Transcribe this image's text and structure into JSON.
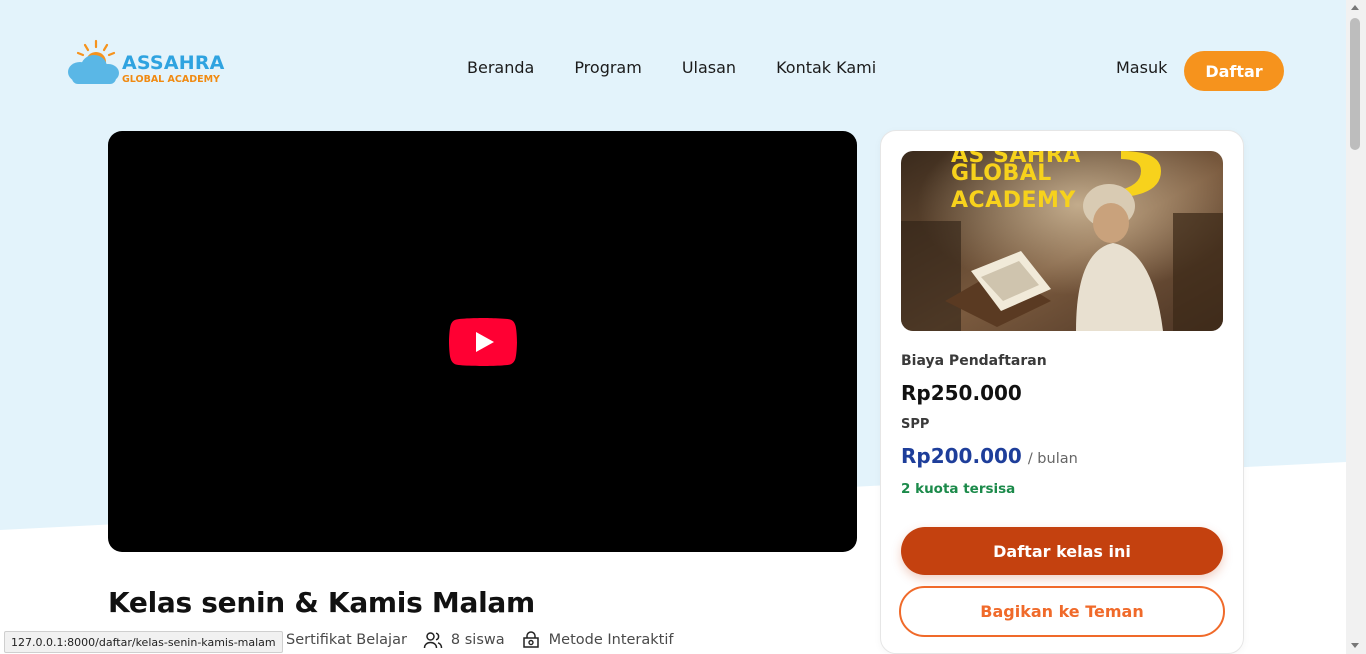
{
  "nav": {
    "logo_title": "ASSAHRA",
    "logo_subtitle": "GLOBAL ACADEMY",
    "links": [
      "Beranda",
      "Program",
      "Ulasan",
      "Kontak Kami"
    ],
    "login_label": "Masuk",
    "register_label": "Daftar"
  },
  "video": {
    "play_icon": "youtube-play-icon"
  },
  "course": {
    "title": "Kelas senin & Kamis Malam",
    "meta": [
      {
        "icon": "certificate-icon",
        "label": "Sertifikat Belajar"
      },
      {
        "icon": "users-icon",
        "label": "8 siswa"
      },
      {
        "icon": "method-icon",
        "label": "Metode Interaktif"
      }
    ]
  },
  "card": {
    "thumbnail_line1": "AS SAHRA",
    "thumbnail_line2": "GLOBAL",
    "thumbnail_line3": "ACADEMY",
    "fee_label": "Biaya Pendaftaran",
    "fee_value": "Rp250.000",
    "spp_label": "SPP",
    "spp_value": "Rp200.000",
    "spp_unit": "/ bulan",
    "quota": "2 kuota tersisa",
    "enroll_label": "Daftar kelas ini",
    "share_label": "Bagikan ke Teman"
  },
  "status_bar": {
    "url": "127.0.0.1:8000/daftar/kelas-senin-kamis-malam"
  },
  "colors": {
    "hero_bg": "#e3f3fb",
    "accent_orange": "#f6931d",
    "enroll_red": "#c4410f",
    "share_orange": "#f06a2a",
    "price_blue": "#1e3e9a",
    "quota_green": "#1b8a4a",
    "logo_blue": "#2fa3e0"
  }
}
